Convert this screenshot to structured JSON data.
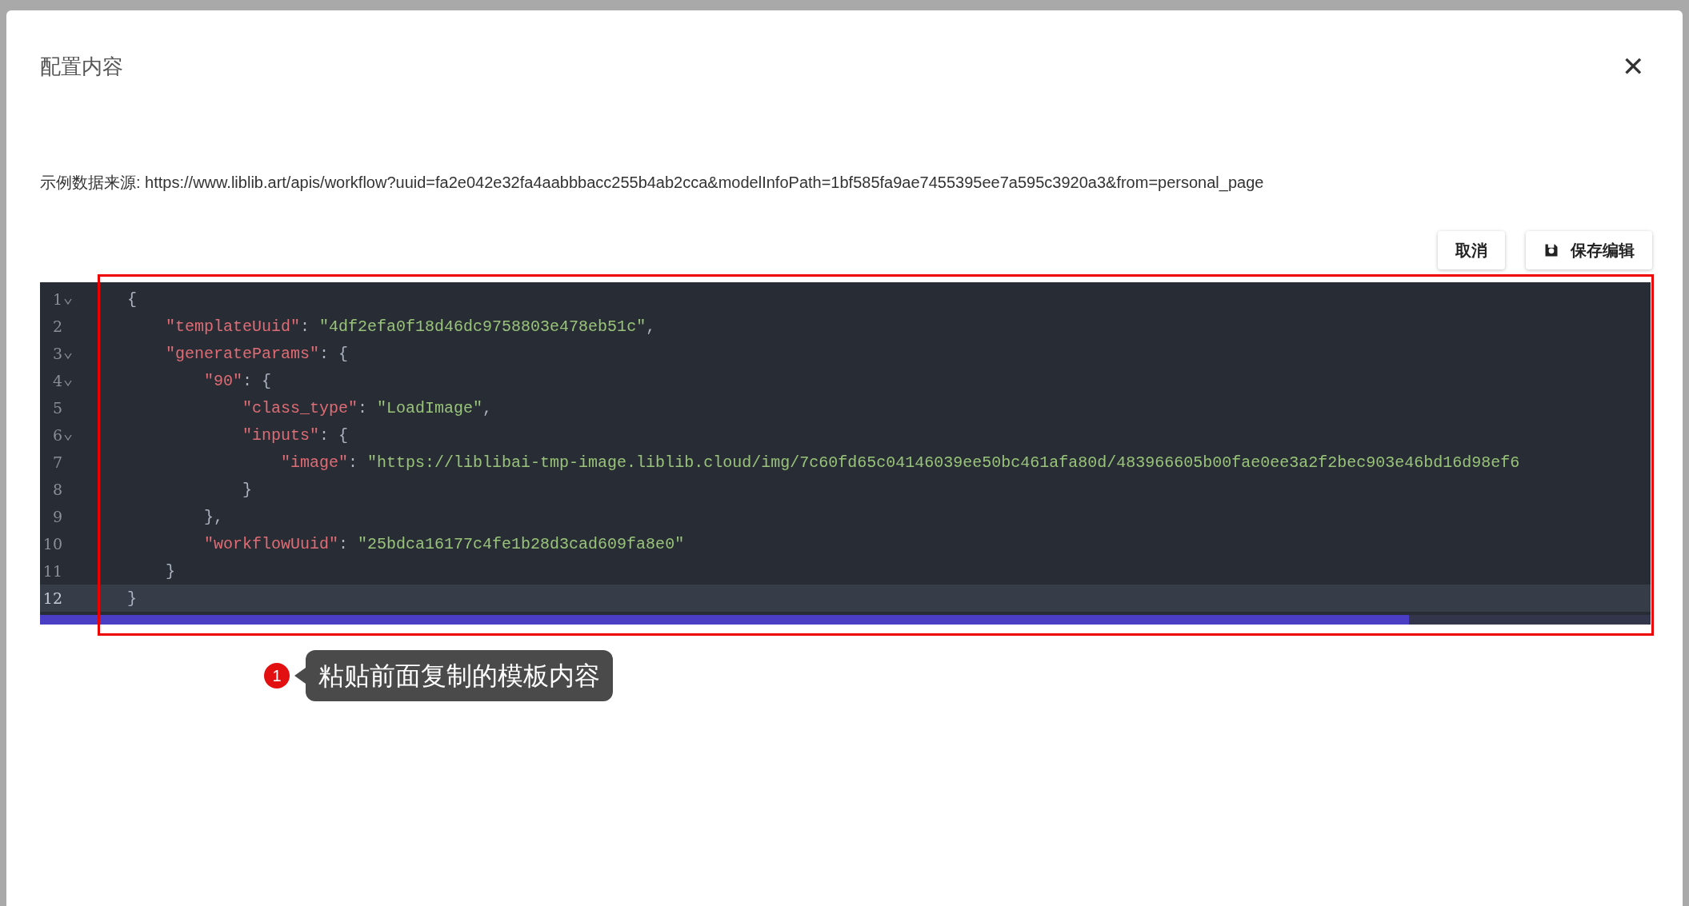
{
  "dialog": {
    "title": "配置内容",
    "close": "✕",
    "source": "示例数据来源: https://www.liblib.art/apis/workflow?uuid=fa2e042e32fa4aabbbacc255b4ab2cca&modelInfoPath=1bf585fa9ae7455395ee7a595c3920a3&from=personal_page"
  },
  "buttons": [
    {
      "label": "取消",
      "kind": "plain"
    },
    {
      "label": "保存编辑",
      "kind": "save"
    }
  ],
  "editor": {
    "lines": [
      {
        "number": "1",
        "foldable": true,
        "active": false,
        "tokens": [
          {
            "kind": "punct",
            "text": "{"
          }
        ]
      },
      {
        "number": "2",
        "foldable": false,
        "active": false,
        "tokens": [
          {
            "kind": "key",
            "text": "    \"templateUuid\""
          },
          {
            "kind": "punct",
            "text": ": "
          },
          {
            "kind": "string",
            "text": "\"4df2efa0f18d46dc9758803e478eb51c\""
          },
          {
            "kind": "punct",
            "text": ","
          }
        ]
      },
      {
        "number": "3",
        "foldable": true,
        "active": false,
        "tokens": [
          {
            "kind": "key",
            "text": "    \"generateParams\""
          },
          {
            "kind": "punct",
            "text": ": {"
          }
        ]
      },
      {
        "number": "4",
        "foldable": true,
        "active": false,
        "tokens": [
          {
            "kind": "key",
            "text": "        \"90\""
          },
          {
            "kind": "punct",
            "text": ": {"
          }
        ]
      },
      {
        "number": "5",
        "foldable": false,
        "active": false,
        "tokens": [
          {
            "kind": "key",
            "text": "            \"class_type\""
          },
          {
            "kind": "punct",
            "text": ": "
          },
          {
            "kind": "string",
            "text": "\"LoadImage\""
          },
          {
            "kind": "punct",
            "text": ","
          }
        ]
      },
      {
        "number": "6",
        "foldable": true,
        "active": false,
        "tokens": [
          {
            "kind": "key",
            "text": "            \"inputs\""
          },
          {
            "kind": "punct",
            "text": ": {"
          }
        ]
      },
      {
        "number": "7",
        "foldable": false,
        "active": false,
        "tokens": [
          {
            "kind": "key",
            "text": "                \"image\""
          },
          {
            "kind": "punct",
            "text": ": "
          },
          {
            "kind": "string",
            "text": "\"https://liblibai-tmp-image.liblib.cloud/img/7c60fd65c04146039ee50bc461afa80d/483966605b00fae0ee3a2f2bec903e46bd16d98ef6"
          }
        ]
      },
      {
        "number": "8",
        "foldable": false,
        "active": false,
        "tokens": [
          {
            "kind": "punct",
            "text": "            }"
          }
        ]
      },
      {
        "number": "9",
        "foldable": false,
        "active": false,
        "tokens": [
          {
            "kind": "punct",
            "text": "        },"
          }
        ]
      },
      {
        "number": "10",
        "foldable": false,
        "active": false,
        "tokens": [
          {
            "kind": "key",
            "text": "        \"workflowUuid\""
          },
          {
            "kind": "punct",
            "text": ": "
          },
          {
            "kind": "string",
            "text": "\"25bdca16177c4fe1b28d3cad609fa8e0\""
          }
        ]
      },
      {
        "number": "11",
        "foldable": false,
        "active": false,
        "tokens": [
          {
            "kind": "punct",
            "text": "    }"
          }
        ]
      },
      {
        "number": "12",
        "foldable": false,
        "active": true,
        "tokens": [
          {
            "kind": "punct",
            "text": "}"
          }
        ]
      }
    ]
  },
  "annotation": {
    "number": "1",
    "text": "粘贴前面复制的模板内容"
  }
}
